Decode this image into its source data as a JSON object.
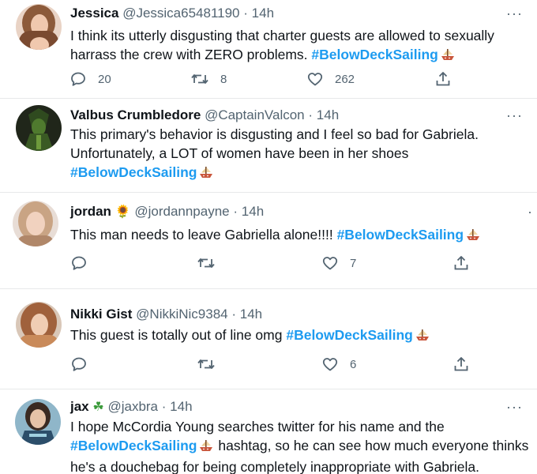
{
  "colors": {
    "hashtag": "#1d9bf0",
    "muted": "#536471",
    "divider": "#e7e9ea"
  },
  "tweets": [
    {
      "name": "Jessica",
      "name_emoji": "",
      "handle": "@Jessica65481190",
      "dot": "·",
      "time": "14h",
      "lines": [
        "I think its utterly disgusting that charter guests are allowed to sexually",
        "harrass the crew with ZERO problems."
      ],
      "hashtag": "#BelowDeckSailing",
      "reply_count": "20",
      "retweet_count": "8",
      "like_count": "262",
      "more": "···"
    },
    {
      "name": "Valbus Crumbledore",
      "name_emoji": "",
      "handle": "@CaptainValcon",
      "dot": "·",
      "time": "14h",
      "lines": [
        "This primary's behavior is disgusting and I feel so bad for Gabriela.",
        "Unfortunately, a LOT of women have been in her shoes"
      ],
      "hashtag": "#BelowDeckSailing",
      "reply_count": "",
      "retweet_count": "",
      "like_count": "",
      "more": "···"
    },
    {
      "name": "jordan",
      "name_emoji": "🌻",
      "handle": "@jordannpayne",
      "dot": "·",
      "time": "14h",
      "lines": [
        "This man needs to leave Gabriella alone!!!!"
      ],
      "hashtag": "#BelowDeckSailing",
      "reply_count": "",
      "retweet_count": "",
      "like_count": "7",
      "more": "·"
    },
    {
      "name": "Nikki Gist",
      "name_emoji": "",
      "handle": "@NikkiNic9384",
      "dot": "·",
      "time": "14h",
      "lines": [
        "This guest is totally out of line omg"
      ],
      "hashtag": "#BelowDeckSailing",
      "reply_count": "",
      "retweet_count": "",
      "like_count": "6",
      "more": ""
    },
    {
      "name": "jax",
      "name_emoji": "☘",
      "handle": "@jaxbra",
      "dot": "·",
      "time": "14h",
      "lines": [
        "I hope McCordia Young searches twitter for his name and the",
        "hashtag, so he can see how much everyone thinks",
        "he's a douchebag for being completely inappropriate with Gabriela."
      ],
      "hashtag": "#BelowDeckSailing",
      "reply_count": "",
      "retweet_count": "",
      "like_count": "",
      "more": "···"
    }
  ]
}
